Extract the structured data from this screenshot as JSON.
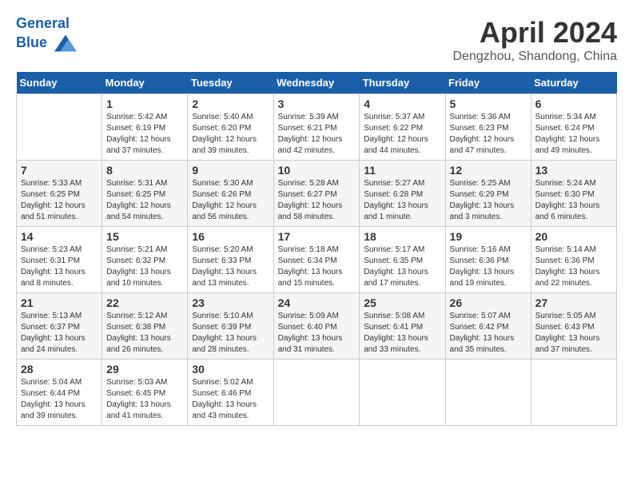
{
  "header": {
    "logo_line1": "General",
    "logo_line2": "Blue",
    "title": "April 2024",
    "location": "Dengzhou, Shandong, China"
  },
  "weekdays": [
    "Sunday",
    "Monday",
    "Tuesday",
    "Wednesday",
    "Thursday",
    "Friday",
    "Saturday"
  ],
  "weeks": [
    [
      {
        "day": "",
        "sunrise": "",
        "sunset": "",
        "daylight": ""
      },
      {
        "day": "1",
        "sunrise": "Sunrise: 5:42 AM",
        "sunset": "Sunset: 6:19 PM",
        "daylight": "Daylight: 12 hours and 37 minutes."
      },
      {
        "day": "2",
        "sunrise": "Sunrise: 5:40 AM",
        "sunset": "Sunset: 6:20 PM",
        "daylight": "Daylight: 12 hours and 39 minutes."
      },
      {
        "day": "3",
        "sunrise": "Sunrise: 5:39 AM",
        "sunset": "Sunset: 6:21 PM",
        "daylight": "Daylight: 12 hours and 42 minutes."
      },
      {
        "day": "4",
        "sunrise": "Sunrise: 5:37 AM",
        "sunset": "Sunset: 6:22 PM",
        "daylight": "Daylight: 12 hours and 44 minutes."
      },
      {
        "day": "5",
        "sunrise": "Sunrise: 5:36 AM",
        "sunset": "Sunset: 6:23 PM",
        "daylight": "Daylight: 12 hours and 47 minutes."
      },
      {
        "day": "6",
        "sunrise": "Sunrise: 5:34 AM",
        "sunset": "Sunset: 6:24 PM",
        "daylight": "Daylight: 12 hours and 49 minutes."
      }
    ],
    [
      {
        "day": "7",
        "sunrise": "Sunrise: 5:33 AM",
        "sunset": "Sunset: 6:25 PM",
        "daylight": "Daylight: 12 hours and 51 minutes."
      },
      {
        "day": "8",
        "sunrise": "Sunrise: 5:31 AM",
        "sunset": "Sunset: 6:25 PM",
        "daylight": "Daylight: 12 hours and 54 minutes."
      },
      {
        "day": "9",
        "sunrise": "Sunrise: 5:30 AM",
        "sunset": "Sunset: 6:26 PM",
        "daylight": "Daylight: 12 hours and 56 minutes."
      },
      {
        "day": "10",
        "sunrise": "Sunrise: 5:28 AM",
        "sunset": "Sunset: 6:27 PM",
        "daylight": "Daylight: 12 hours and 58 minutes."
      },
      {
        "day": "11",
        "sunrise": "Sunrise: 5:27 AM",
        "sunset": "Sunset: 6:28 PM",
        "daylight": "Daylight: 13 hours and 1 minute."
      },
      {
        "day": "12",
        "sunrise": "Sunrise: 5:25 AM",
        "sunset": "Sunset: 6:29 PM",
        "daylight": "Daylight: 13 hours and 3 minutes."
      },
      {
        "day": "13",
        "sunrise": "Sunrise: 5:24 AM",
        "sunset": "Sunset: 6:30 PM",
        "daylight": "Daylight: 13 hours and 6 minutes."
      }
    ],
    [
      {
        "day": "14",
        "sunrise": "Sunrise: 5:23 AM",
        "sunset": "Sunset: 6:31 PM",
        "daylight": "Daylight: 13 hours and 8 minutes."
      },
      {
        "day": "15",
        "sunrise": "Sunrise: 5:21 AM",
        "sunset": "Sunset: 6:32 PM",
        "daylight": "Daylight: 13 hours and 10 minutes."
      },
      {
        "day": "16",
        "sunrise": "Sunrise: 5:20 AM",
        "sunset": "Sunset: 6:33 PM",
        "daylight": "Daylight: 13 hours and 13 minutes."
      },
      {
        "day": "17",
        "sunrise": "Sunrise: 5:18 AM",
        "sunset": "Sunset: 6:34 PM",
        "daylight": "Daylight: 13 hours and 15 minutes."
      },
      {
        "day": "18",
        "sunrise": "Sunrise: 5:17 AM",
        "sunset": "Sunset: 6:35 PM",
        "daylight": "Daylight: 13 hours and 17 minutes."
      },
      {
        "day": "19",
        "sunrise": "Sunrise: 5:16 AM",
        "sunset": "Sunset: 6:36 PM",
        "daylight": "Daylight: 13 hours and 19 minutes."
      },
      {
        "day": "20",
        "sunrise": "Sunrise: 5:14 AM",
        "sunset": "Sunset: 6:36 PM",
        "daylight": "Daylight: 13 hours and 22 minutes."
      }
    ],
    [
      {
        "day": "21",
        "sunrise": "Sunrise: 5:13 AM",
        "sunset": "Sunset: 6:37 PM",
        "daylight": "Daylight: 13 hours and 24 minutes."
      },
      {
        "day": "22",
        "sunrise": "Sunrise: 5:12 AM",
        "sunset": "Sunset: 6:38 PM",
        "daylight": "Daylight: 13 hours and 26 minutes."
      },
      {
        "day": "23",
        "sunrise": "Sunrise: 5:10 AM",
        "sunset": "Sunset: 6:39 PM",
        "daylight": "Daylight: 13 hours and 28 minutes."
      },
      {
        "day": "24",
        "sunrise": "Sunrise: 5:09 AM",
        "sunset": "Sunset: 6:40 PM",
        "daylight": "Daylight: 13 hours and 31 minutes."
      },
      {
        "day": "25",
        "sunrise": "Sunrise: 5:08 AM",
        "sunset": "Sunset: 6:41 PM",
        "daylight": "Daylight: 13 hours and 33 minutes."
      },
      {
        "day": "26",
        "sunrise": "Sunrise: 5:07 AM",
        "sunset": "Sunset: 6:42 PM",
        "daylight": "Daylight: 13 hours and 35 minutes."
      },
      {
        "day": "27",
        "sunrise": "Sunrise: 5:05 AM",
        "sunset": "Sunset: 6:43 PM",
        "daylight": "Daylight: 13 hours and 37 minutes."
      }
    ],
    [
      {
        "day": "28",
        "sunrise": "Sunrise: 5:04 AM",
        "sunset": "Sunset: 6:44 PM",
        "daylight": "Daylight: 13 hours and 39 minutes."
      },
      {
        "day": "29",
        "sunrise": "Sunrise: 5:03 AM",
        "sunset": "Sunset: 6:45 PM",
        "daylight": "Daylight: 13 hours and 41 minutes."
      },
      {
        "day": "30",
        "sunrise": "Sunrise: 5:02 AM",
        "sunset": "Sunset: 6:46 PM",
        "daylight": "Daylight: 13 hours and 43 minutes."
      },
      {
        "day": "",
        "sunrise": "",
        "sunset": "",
        "daylight": ""
      },
      {
        "day": "",
        "sunrise": "",
        "sunset": "",
        "daylight": ""
      },
      {
        "day": "",
        "sunrise": "",
        "sunset": "",
        "daylight": ""
      },
      {
        "day": "",
        "sunrise": "",
        "sunset": "",
        "daylight": ""
      }
    ]
  ]
}
